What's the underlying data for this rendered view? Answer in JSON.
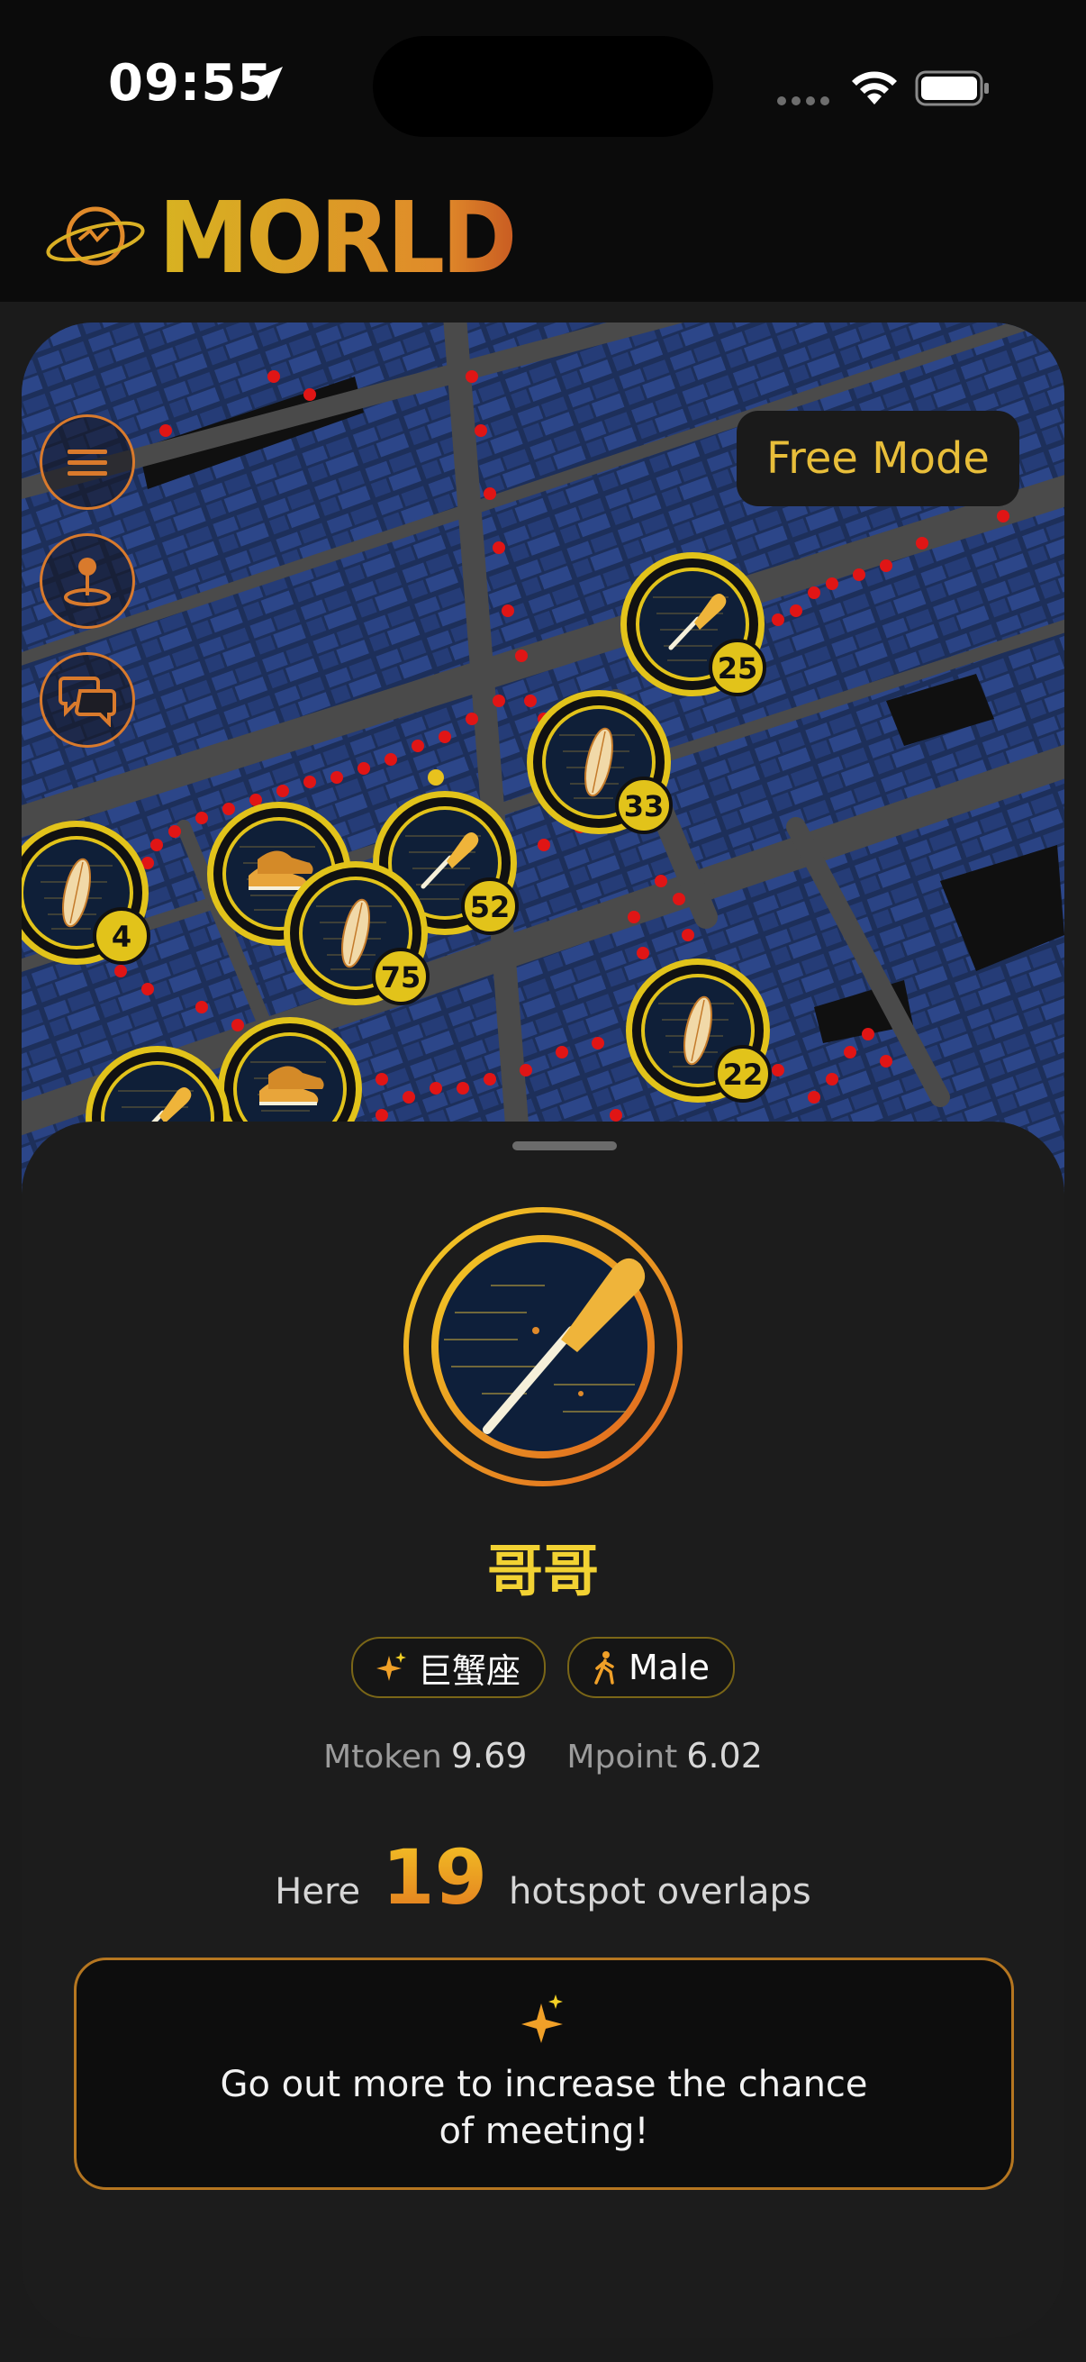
{
  "status_bar": {
    "time": "09:55"
  },
  "header": {
    "logo_text": "MORLD"
  },
  "map": {
    "mode_label": "Free Mode",
    "buttons": [
      "menu-icon",
      "location-pin-icon",
      "chat-icon"
    ],
    "clusters": [
      {
        "icon": "paddle",
        "count": "25"
      },
      {
        "icon": "surfboard",
        "count": "33"
      },
      {
        "icon": "paddle",
        "count": "52"
      },
      {
        "icon": "surfboard",
        "count": "4"
      },
      {
        "icon": "sneakers",
        "count": ""
      },
      {
        "icon": "surfboard",
        "count": "75"
      },
      {
        "icon": "surfboard",
        "count": "22"
      },
      {
        "icon": "sneakers",
        "count": ""
      },
      {
        "icon": "paddle",
        "count": ""
      }
    ]
  },
  "profile": {
    "name": "哥哥",
    "zodiac": "巨蟹座",
    "gender": "Male",
    "mtoken_label": "Mtoken",
    "mtoken_value": "9.69",
    "mpoint_label": "Mpoint",
    "mpoint_value": "6.02"
  },
  "hotspot": {
    "prefix": "Here",
    "count": "19",
    "suffix": "hotspot overlaps"
  },
  "tip": {
    "line1": "Go out more to increase the chance",
    "line2": "of meeting!"
  },
  "colors": {
    "accent_yellow": "#f2d233",
    "accent_orange": "#e0772a",
    "map_block": "#26407a"
  }
}
